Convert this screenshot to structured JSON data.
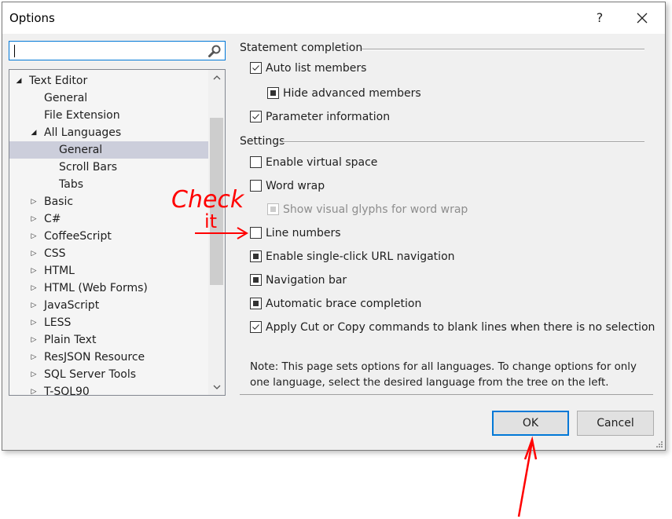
{
  "dialog": {
    "title": "Options",
    "help_label": "?",
    "close_icon": "close-icon"
  },
  "search": {
    "value": "",
    "placeholder": "",
    "icon": "search-icon"
  },
  "tree": {
    "items": [
      {
        "label": "Text Editor",
        "level": 0,
        "expander": "expanded"
      },
      {
        "label": "General",
        "level": 1,
        "expander": "none"
      },
      {
        "label": "File Extension",
        "level": 1,
        "expander": "none"
      },
      {
        "label": "All Languages",
        "level": 1,
        "expander": "expanded"
      },
      {
        "label": "General",
        "level": 2,
        "expander": "none",
        "selected": true
      },
      {
        "label": "Scroll Bars",
        "level": 2,
        "expander": "none"
      },
      {
        "label": "Tabs",
        "level": 2,
        "expander": "none"
      },
      {
        "label": "Basic",
        "level": 1,
        "expander": "collapsed"
      },
      {
        "label": "C#",
        "level": 1,
        "expander": "collapsed"
      },
      {
        "label": "CoffeeScript",
        "level": 1,
        "expander": "collapsed"
      },
      {
        "label": "CSS",
        "level": 1,
        "expander": "collapsed"
      },
      {
        "label": "HTML",
        "level": 1,
        "expander": "collapsed"
      },
      {
        "label": "HTML (Web Forms)",
        "level": 1,
        "expander": "collapsed"
      },
      {
        "label": "JavaScript",
        "level": 1,
        "expander": "collapsed"
      },
      {
        "label": "LESS",
        "level": 1,
        "expander": "collapsed"
      },
      {
        "label": "Plain Text",
        "level": 1,
        "expander": "collapsed"
      },
      {
        "label": "ResJSON Resource",
        "level": 1,
        "expander": "collapsed"
      },
      {
        "label": "SQL Server Tools",
        "level": 1,
        "expander": "collapsed"
      },
      {
        "label": "T-SQL90",
        "level": 1,
        "expander": "collapsed"
      }
    ],
    "scroll_up_icon": "chevron-up-icon",
    "scroll_down_icon": "chevron-down-icon"
  },
  "sections": {
    "statement_completion": {
      "heading": "Statement completion",
      "options": [
        {
          "label": "Auto list members",
          "state": "checked",
          "indent": 0
        },
        {
          "label": "Hide advanced members",
          "state": "indeterminate",
          "indent": 1
        },
        {
          "label": "Parameter information",
          "state": "checked",
          "indent": 0
        }
      ]
    },
    "settings": {
      "heading": "Settings",
      "options": [
        {
          "label": "Enable virtual space",
          "state": "unchecked",
          "indent": 0
        },
        {
          "label": "Word wrap",
          "state": "unchecked",
          "indent": 0
        },
        {
          "label": "Show visual glyphs for word wrap",
          "state": "indeterminate",
          "indent": 1,
          "disabled": true
        },
        {
          "label": "Line numbers",
          "state": "unchecked",
          "indent": 0
        },
        {
          "label": "Enable single-click URL navigation",
          "state": "indeterminate",
          "indent": 0
        },
        {
          "label": "Navigation bar",
          "state": "indeterminate",
          "indent": 0
        },
        {
          "label": "Automatic brace completion",
          "state": "indeterminate",
          "indent": 0
        },
        {
          "label": "Apply Cut or Copy commands to blank lines when there is no selection",
          "state": "checked",
          "indent": 0
        }
      ]
    }
  },
  "note": {
    "line1": "Note: This page sets options for all languages. To change options for only",
    "line2": "one language, select the desired language from the tree on the left."
  },
  "buttons": {
    "ok_label": "OK",
    "cancel_label": "Cancel"
  },
  "annotation": {
    "text_line1": "Check",
    "text_line2": "it",
    "color": "#ff0000"
  },
  "colors": {
    "accent": "#0078d7",
    "selection": "#cccedb",
    "dialog_bg": "#f0f0f0"
  }
}
